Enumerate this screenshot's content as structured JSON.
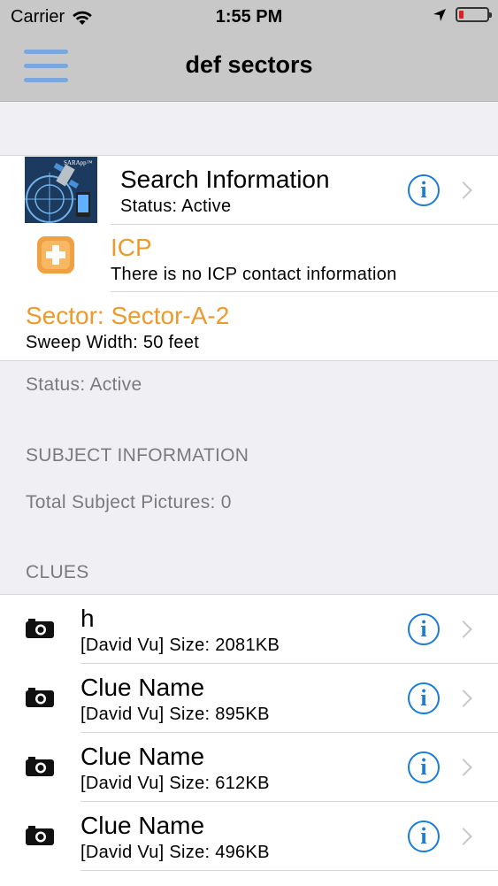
{
  "status_bar": {
    "carrier": "Carrier",
    "time": "1:55 PM"
  },
  "nav": {
    "title": "def sectors",
    "menu_icon": "hamburger-menu-icon"
  },
  "search_info": {
    "title": "Search Information",
    "status": "Status: Active",
    "thumb_text": "SARApp™"
  },
  "icp": {
    "title": "ICP",
    "detail": "There is no ICP contact information"
  },
  "sector": {
    "title": "Sector: Sector-A-2",
    "sweep": "Sweep Width: 50 feet"
  },
  "sector_status": "Status: Active",
  "subject": {
    "header": "SUBJECT INFORMATION",
    "pictures": "Total Subject Pictures: 0"
  },
  "clues_header": "CLUES",
  "clues": [
    {
      "name": "h",
      "detail": "[David Vu] Size: 2081KB"
    },
    {
      "name": "Clue Name",
      "detail": "[David Vu] Size: 895KB"
    },
    {
      "name": "Clue Name",
      "detail": "[David Vu] Size: 612KB"
    },
    {
      "name": "Clue Name",
      "detail": "[David Vu] Size: 496KB"
    }
  ],
  "colors": {
    "accent_blue": "#1a7bd8",
    "orange": "#ec9a2c",
    "menu_blue": "#7aa8dc",
    "battery_red": "#e02020"
  }
}
